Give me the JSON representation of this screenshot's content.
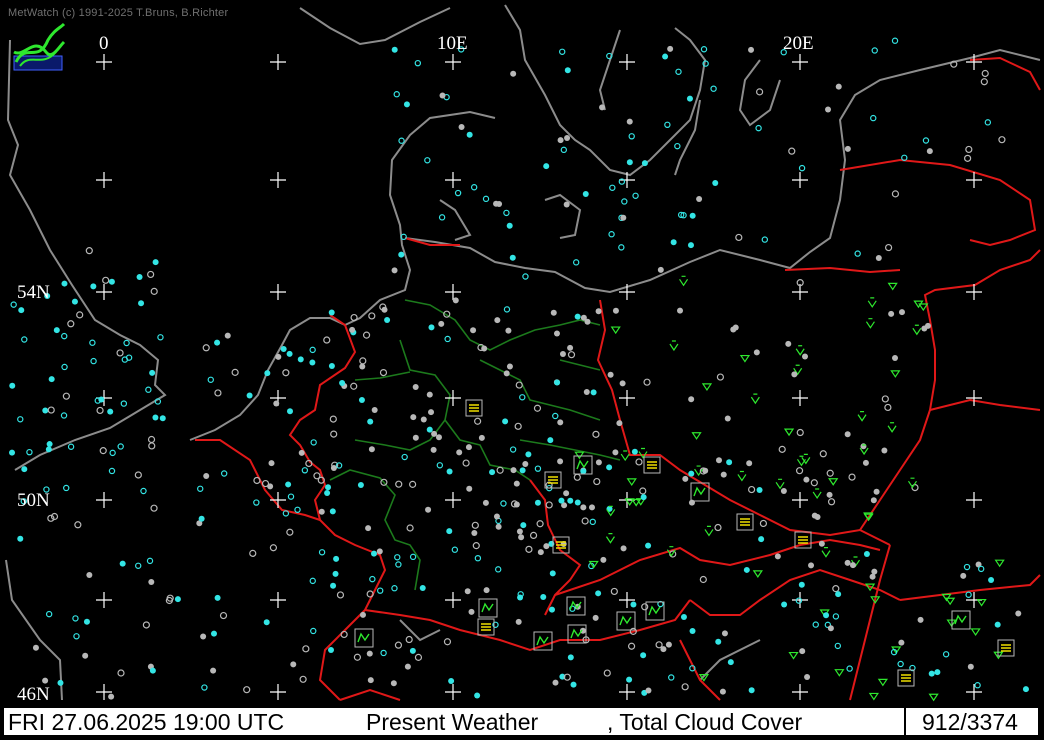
{
  "credit": "MetWatch  (c) 1991-2025 T.Bruns, B.Richter",
  "grid": {
    "lon_labels": [
      "0",
      "10E",
      "20E"
    ],
    "lat_labels": [
      "54N",
      "50N",
      "46N"
    ]
  },
  "status": {
    "datetime": "FRI 27.06.2025 19:00 UTC",
    "parameter1": "Present Weather",
    "parameter2": ", Total Cloud Cover",
    "count": "912/3374"
  },
  "colors": {
    "background": "#000000",
    "coastline": "#8c8c8c",
    "border": "#e01818",
    "state_border": "#1c7a1c",
    "clear": "#33e5e5",
    "cloud": "#b8b8b8",
    "weather": "#2ee82e",
    "fog_box": "#f0e000"
  }
}
